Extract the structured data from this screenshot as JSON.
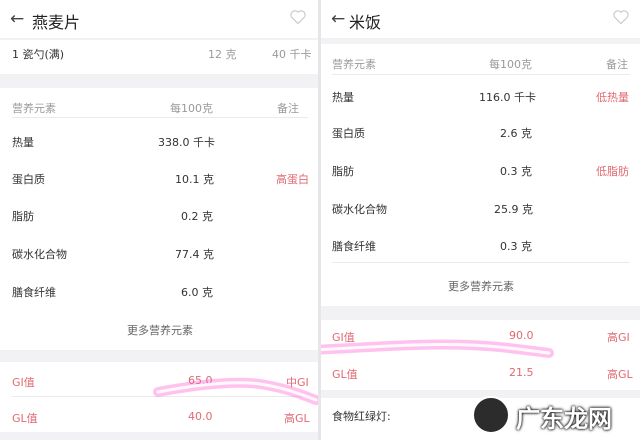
{
  "left": {
    "title": "燕麦片",
    "back_icon": "arrow-left-icon",
    "favorite_icon": "heart-outline-icon",
    "portion": {
      "label": "1 瓷勺(满)",
      "grams": "12 克",
      "kcal": "40 千卡"
    },
    "table_header": {
      "col1": "营养元素",
      "col2": "每100克",
      "col3": "备注"
    },
    "nutrients": [
      {
        "name": "热量",
        "value": "338.0 千卡",
        "note": ""
      },
      {
        "name": "蛋白质",
        "value": "10.1 克",
        "note": "高蛋白"
      },
      {
        "name": "脂肪",
        "value": "0.2 克",
        "note": ""
      },
      {
        "name": "碳水化合物",
        "value": "77.4 克",
        "note": ""
      },
      {
        "name": "膳食纤维",
        "value": "6.0 克",
        "note": ""
      }
    ],
    "more_link": "更多营养元素",
    "gi": {
      "label": "GI值",
      "value": "65.0",
      "level": "中GI"
    },
    "gl": {
      "label": "GL值",
      "value": "40.0",
      "level": "高GL"
    }
  },
  "right": {
    "title": "米饭",
    "back_icon": "arrow-left-icon",
    "favorite_icon": "heart-outline-icon",
    "table_header": {
      "col1": "营养元素",
      "col2": "每100克",
      "col3": "备注"
    },
    "nutrients": [
      {
        "name": "热量",
        "value": "116.0 千卡",
        "note": "低热量"
      },
      {
        "name": "蛋白质",
        "value": "2.6 克",
        "note": ""
      },
      {
        "name": "脂肪",
        "value": "0.3 克",
        "note": "低脂肪"
      },
      {
        "name": "碳水化合物",
        "value": "25.9 克",
        "note": ""
      },
      {
        "name": "膳食纤维",
        "value": "0.3 克",
        "note": ""
      }
    ],
    "more_link": "更多营养元素",
    "gi": {
      "label": "GI值",
      "value": "90.0",
      "level": "高GI"
    },
    "gl": {
      "label": "GL值",
      "value": "21.5",
      "level": "高GL"
    },
    "traffic_light": "食物红绿灯:"
  },
  "watermark": {
    "text": "广东龙网"
  },
  "colors": {
    "accent_red": "#e06a72",
    "highlight": "#ff4fd0",
    "band": "#f2f2f4"
  }
}
